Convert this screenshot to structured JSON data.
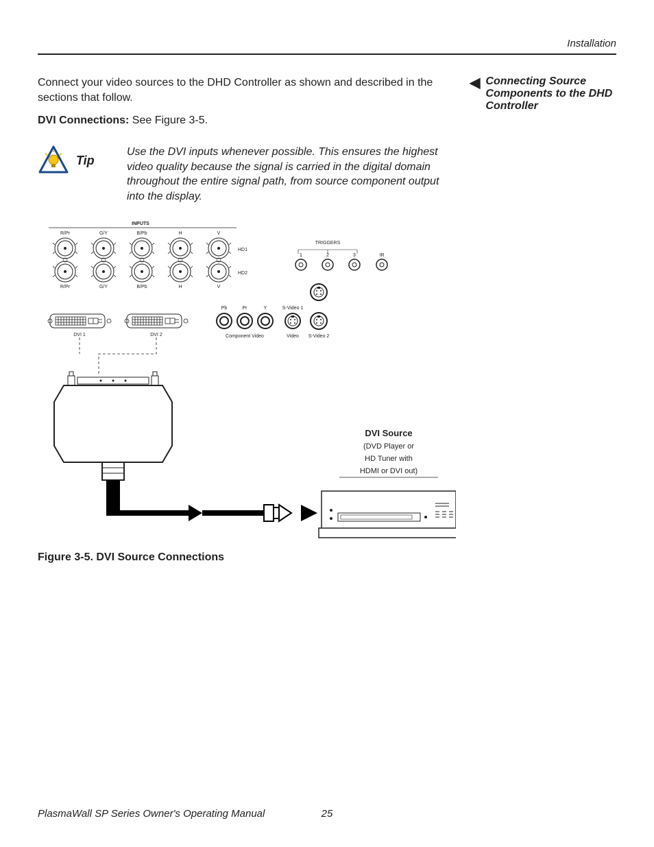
{
  "header": {
    "section": "Installation"
  },
  "sidebar": {
    "arrow_glyph": "◀",
    "heading": "Connecting Source Components to the DHD Controller"
  },
  "intro_text": "Connect your video sources to the DHD Controller as shown and described in the sections that follow.",
  "dvi_line": {
    "bold": "DVI Connections: ",
    "rest": "See Figure 3-5."
  },
  "tip": {
    "label": "Tip",
    "text": "Use the DVI inputs whenever possible. This ensures the highest video quality because the signal is carried in the digital domain throughout the entire signal path, from source component output into the display."
  },
  "diagram": {
    "inputs_label": "INPUTS",
    "bnc_top": [
      "R/Pr",
      "G/Y",
      "B/Pb",
      "H",
      "V"
    ],
    "bnc_row1_right": "HD1",
    "bnc_row2_right": "HD2",
    "bnc_bottom": [
      "R/Pr",
      "G/Y",
      "B/Pb",
      "H",
      "V"
    ],
    "dvi1": "DVI 1",
    "dvi2": "DVI 2",
    "comp_top": [
      "Pb",
      "Pr",
      "Y",
      "S-Video 1"
    ],
    "comp_bottom_left": "Component Video",
    "comp_bottom_mid": "Video",
    "comp_bottom_right": "S-Video 2",
    "triggers_label": "TRIGGERS",
    "triggers": [
      "1",
      "2",
      "3"
    ],
    "ir_label": "IR",
    "source_title": "DVI Source",
    "source_sub1": "(DVD Player or",
    "source_sub2": "HD Tuner with",
    "source_sub3": "HDMI or DVI out)"
  },
  "figure_caption": "Figure 3-5. DVI Source Connections",
  "footer": {
    "title": "PlasmaWall SP Series Owner's Operating Manual",
    "page": "25"
  }
}
